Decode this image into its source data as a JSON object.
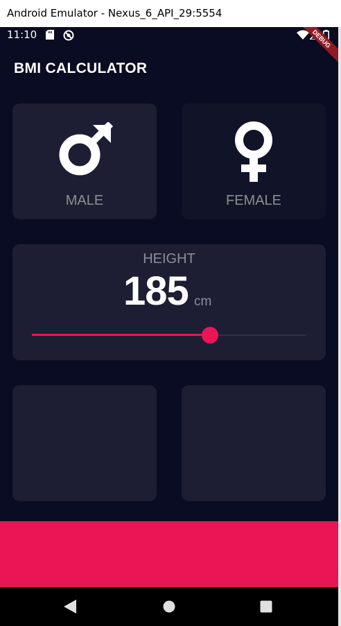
{
  "window": {
    "title": "Android Emulator - Nexus_6_API_29:5554"
  },
  "status_bar": {
    "time": "11:10",
    "debug_banner": "DEBUG"
  },
  "app_bar": {
    "title": "BMI CALCULATOR"
  },
  "gender": {
    "male_label": "MALE",
    "female_label": "FEMALE",
    "male_icon": "mars-icon",
    "female_icon": "venus-icon"
  },
  "height": {
    "label": "HEIGHT",
    "value": "185",
    "unit": "cm",
    "slider_fraction": 0.65
  },
  "colors": {
    "background": "#090c22",
    "active_card": "#1d1e33",
    "inactive_card": "#111328",
    "accent": "#eb1555",
    "label": "#8d8e98"
  }
}
